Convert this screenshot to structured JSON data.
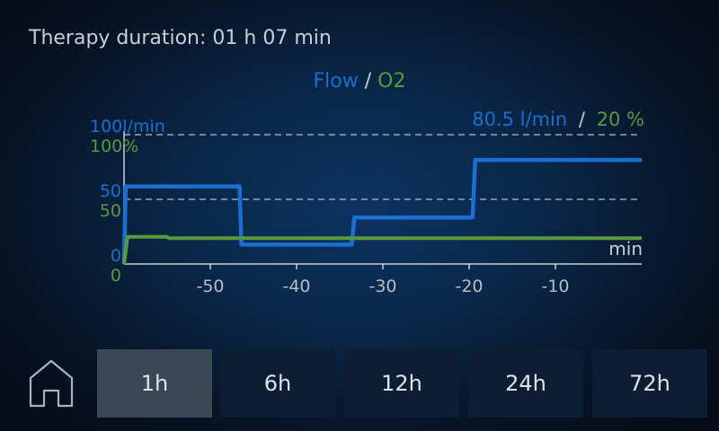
{
  "header": {
    "duration_label": "Therapy duration: 01 h 07 min"
  },
  "chart_title": {
    "flow": "Flow",
    "separator": "/",
    "o2": "O2"
  },
  "current": {
    "flow": "80.5 l/min",
    "separator": "/",
    "o2": "20 %"
  },
  "chart_data": {
    "type": "line",
    "xlabel": "min",
    "xlim": [
      -60,
      0
    ],
    "x_ticks": [
      "-50",
      "-40",
      "-30",
      "-20",
      "-10"
    ],
    "y_left_flow": {
      "ticks": [
        "100l/min",
        "50",
        "0"
      ],
      "ylim": [
        0,
        100
      ]
    },
    "y_left_o2": {
      "ticks": [
        "100%",
        "50",
        "0"
      ],
      "ylim": [
        0,
        100
      ]
    },
    "grid": "dashed at 50 and 100",
    "colors": {
      "flow": "#1a6fd0",
      "o2": "#5a9a3c"
    },
    "series": [
      {
        "name": "Flow",
        "x": [
          -60,
          -59.8,
          -46.6,
          -46.4,
          -33.6,
          -33.3,
          -19.6,
          -19.3,
          0
        ],
        "y": [
          0,
          60,
          60,
          15,
          15,
          36,
          36,
          80.5,
          80.5
        ]
      },
      {
        "name": "O2",
        "x": [
          -60,
          -59.6,
          -55,
          -54.8,
          0
        ],
        "y": [
          0,
          21,
          21,
          20,
          20
        ]
      }
    ]
  },
  "time_tabs": [
    {
      "label": "1h",
      "active": true
    },
    {
      "label": "6h",
      "active": false
    },
    {
      "label": "12h",
      "active": false
    },
    {
      "label": "24h",
      "active": false
    },
    {
      "label": "72h",
      "active": false
    }
  ],
  "home_icon": "home-icon"
}
